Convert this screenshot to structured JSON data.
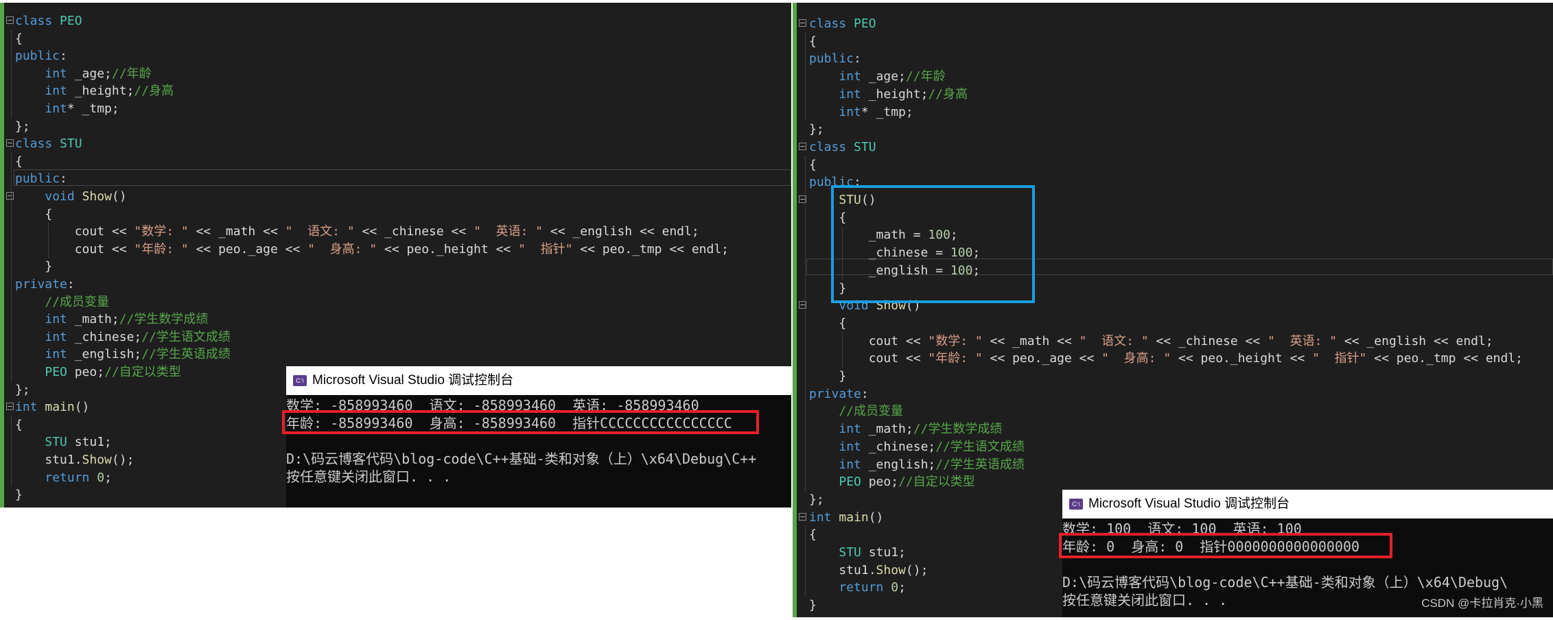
{
  "left_editor": {
    "lines": [
      [
        [
          "k",
          "class "
        ],
        [
          "t",
          "PEO"
        ]
      ],
      [
        [
          "m",
          "{"
        ]
      ],
      [
        [
          "k",
          "public"
        ],
        [
          "m",
          ":"
        ]
      ],
      [
        [
          "m",
          "    "
        ],
        [
          "k",
          "int"
        ],
        [
          "m",
          " _age;"
        ],
        [
          "c",
          "//年龄"
        ]
      ],
      [
        [
          "m",
          "    "
        ],
        [
          "k",
          "int"
        ],
        [
          "m",
          " _height;"
        ],
        [
          "c",
          "//身高"
        ]
      ],
      [
        [
          "m",
          "    "
        ],
        [
          "k",
          "int"
        ],
        [
          "m",
          "* _tmp;"
        ]
      ],
      [
        [
          "m",
          "};"
        ]
      ],
      [
        [
          "k",
          "class "
        ],
        [
          "t",
          "STU"
        ]
      ],
      [
        [
          "m",
          "{"
        ]
      ],
      [
        [
          "k",
          "public"
        ],
        [
          "m",
          ":"
        ]
      ],
      [
        [
          "m",
          "    "
        ],
        [
          "k",
          "void"
        ],
        [
          "m",
          " "
        ],
        [
          "f",
          "Show"
        ],
        [
          "m",
          "()"
        ]
      ],
      [
        [
          "m",
          "    {"
        ]
      ],
      [
        [
          "m",
          "        cout << "
        ],
        [
          "s",
          "\"数学: \""
        ],
        [
          "m",
          " << _math << "
        ],
        [
          "s",
          "\"  语文: \""
        ],
        [
          "m",
          " << _chinese << "
        ],
        [
          "s",
          "\"  英语: \""
        ],
        [
          "m",
          " << _english << endl;"
        ]
      ],
      [
        [
          "m",
          "        cout << "
        ],
        [
          "s",
          "\"年龄: \""
        ],
        [
          "m",
          " << peo._age << "
        ],
        [
          "s",
          "\"  身高: \""
        ],
        [
          "m",
          " << peo._height << "
        ],
        [
          "s",
          "\"  指针\""
        ],
        [
          "m",
          " << peo._tmp << endl;"
        ]
      ],
      [
        [
          "m",
          "    }"
        ]
      ],
      [
        [
          "k",
          "private"
        ],
        [
          "m",
          ":"
        ]
      ],
      [
        [
          "m",
          "    "
        ],
        [
          "c",
          "//成员变量"
        ]
      ],
      [
        [
          "m",
          "    "
        ],
        [
          "k",
          "int"
        ],
        [
          "m",
          " _math;"
        ],
        [
          "c",
          "//学生数学成绩"
        ]
      ],
      [
        [
          "m",
          "    "
        ],
        [
          "k",
          "int"
        ],
        [
          "m",
          " _chinese;"
        ],
        [
          "c",
          "//学生语文成绩"
        ]
      ],
      [
        [
          "m",
          "    "
        ],
        [
          "k",
          "int"
        ],
        [
          "m",
          " _english;"
        ],
        [
          "c",
          "//学生英语成绩"
        ]
      ],
      [
        [
          "m",
          "    "
        ],
        [
          "t",
          "PEO"
        ],
        [
          "m",
          " peo;"
        ],
        [
          "c",
          "//自定以类型"
        ]
      ],
      [
        [
          "m",
          "};"
        ]
      ],
      [
        [
          "k",
          "int"
        ],
        [
          "m",
          " "
        ],
        [
          "f",
          "main"
        ],
        [
          "m",
          "()"
        ]
      ],
      [
        [
          "m",
          "{"
        ]
      ],
      [
        [
          "m",
          "    "
        ],
        [
          "t",
          "STU"
        ],
        [
          "m",
          " stu1;"
        ]
      ],
      [
        [
          "m",
          "    stu1."
        ],
        [
          "f",
          "Show"
        ],
        [
          "m",
          "();"
        ]
      ],
      [
        [
          "m",
          "    "
        ],
        [
          "k",
          "return"
        ],
        [
          "m",
          " "
        ],
        [
          "n",
          "0"
        ],
        [
          "m",
          ";"
        ]
      ],
      [
        [
          "m",
          "}"
        ]
      ]
    ]
  },
  "right_editor": {
    "lines": [
      [
        [
          "k",
          "class "
        ],
        [
          "t",
          "PEO"
        ]
      ],
      [
        [
          "m",
          "{"
        ]
      ],
      [
        [
          "k",
          "public"
        ],
        [
          "m",
          ":"
        ]
      ],
      [
        [
          "m",
          "    "
        ],
        [
          "k",
          "int"
        ],
        [
          "m",
          " _age;"
        ],
        [
          "c",
          "//年龄"
        ]
      ],
      [
        [
          "m",
          "    "
        ],
        [
          "k",
          "int"
        ],
        [
          "m",
          " _height;"
        ],
        [
          "c",
          "//身高"
        ]
      ],
      [
        [
          "m",
          "    "
        ],
        [
          "k",
          "int"
        ],
        [
          "m",
          "* _tmp;"
        ]
      ],
      [
        [
          "m",
          "};"
        ]
      ],
      [
        [
          "k",
          "class "
        ],
        [
          "t",
          "STU"
        ]
      ],
      [
        [
          "m",
          "{"
        ]
      ],
      [
        [
          "k",
          "public"
        ],
        [
          "m",
          ":"
        ]
      ],
      [
        [
          "m",
          "    "
        ],
        [
          "f",
          "STU"
        ],
        [
          "m",
          "()"
        ]
      ],
      [
        [
          "m",
          "    {"
        ]
      ],
      [
        [
          "m",
          "        _math = "
        ],
        [
          "n",
          "100"
        ],
        [
          "m",
          ";"
        ]
      ],
      [
        [
          "m",
          "        _chinese = "
        ],
        [
          "n",
          "100"
        ],
        [
          "m",
          ";"
        ]
      ],
      [
        [
          "m",
          "        _english = "
        ],
        [
          "n",
          "100"
        ],
        [
          "m",
          ";"
        ]
      ],
      [
        [
          "m",
          "    }"
        ]
      ],
      [
        [
          "m",
          "    "
        ],
        [
          "k",
          "void"
        ],
        [
          "m",
          " "
        ],
        [
          "f",
          "Show"
        ],
        [
          "m",
          "()"
        ]
      ],
      [
        [
          "m",
          "    {"
        ]
      ],
      [
        [
          "m",
          "        cout << "
        ],
        [
          "s",
          "\"数学: \""
        ],
        [
          "m",
          " << _math << "
        ],
        [
          "s",
          "\"  语文: \""
        ],
        [
          "m",
          " << _chinese << "
        ],
        [
          "s",
          "\"  英语: \""
        ],
        [
          "m",
          " << _english << endl;"
        ]
      ],
      [
        [
          "m",
          "        cout << "
        ],
        [
          "s",
          "\"年龄: \""
        ],
        [
          "m",
          " << peo._age << "
        ],
        [
          "s",
          "\"  身高: \""
        ],
        [
          "m",
          " << peo._height << "
        ],
        [
          "s",
          "\"  指针\""
        ],
        [
          "m",
          " << peo._tmp << endl;"
        ]
      ],
      [
        [
          "m",
          "    }"
        ]
      ],
      [
        [
          "k",
          "private"
        ],
        [
          "m",
          ":"
        ]
      ],
      [
        [
          "m",
          "    "
        ],
        [
          "c",
          "//成员变量"
        ]
      ],
      [
        [
          "m",
          "    "
        ],
        [
          "k",
          "int"
        ],
        [
          "m",
          " _math;"
        ],
        [
          "c",
          "//学生数学成绩"
        ]
      ],
      [
        [
          "m",
          "    "
        ],
        [
          "k",
          "int"
        ],
        [
          "m",
          " _chinese;"
        ],
        [
          "c",
          "//学生语文成绩"
        ]
      ],
      [
        [
          "m",
          "    "
        ],
        [
          "k",
          "int"
        ],
        [
          "m",
          " _english;"
        ],
        [
          "c",
          "//学生英语成绩"
        ]
      ],
      [
        [
          "m",
          "    "
        ],
        [
          "t",
          "PEO"
        ],
        [
          "m",
          " peo;"
        ],
        [
          "c",
          "//自定以类型"
        ]
      ],
      [
        [
          "m",
          "};"
        ]
      ],
      [
        [
          "k",
          "int"
        ],
        [
          "m",
          " "
        ],
        [
          "f",
          "main"
        ],
        [
          "m",
          "()"
        ]
      ],
      [
        [
          "m",
          "{"
        ]
      ],
      [
        [
          "m",
          "    "
        ],
        [
          "t",
          "STU"
        ],
        [
          "m",
          " stu1;"
        ]
      ],
      [
        [
          "m",
          "    stu1."
        ],
        [
          "f",
          "Show"
        ],
        [
          "m",
          "();"
        ]
      ],
      [
        [
          "m",
          "    "
        ],
        [
          "k",
          "return"
        ],
        [
          "m",
          " "
        ],
        [
          "n",
          "0"
        ],
        [
          "m",
          ";"
        ]
      ],
      [
        [
          "m",
          "}"
        ]
      ]
    ]
  },
  "left_console": {
    "title": "Microsoft Visual Studio 调试控制台",
    "lines": [
      "数学: -858993460  语文: -858993460  英语: -858993460",
      "年龄: -858993460  身高: -858993460  指针CCCCCCCCCCCCCCCC",
      "",
      "D:\\码云博客代码\\blog-code\\C++基础-类和对象（上）\\x64\\Debug\\C++",
      "按任意键关闭此窗口. . ."
    ]
  },
  "right_console": {
    "title": "Microsoft Visual Studio 调试控制台",
    "lines": [
      "数学: 100  语文: 100  英语: 100",
      "年龄: 0  身高: 0  指针0000000000000000",
      "",
      "D:\\码云博客代码\\blog-code\\C++基础-类和对象（上）\\x64\\Debug\\",
      "按任意键关闭此窗口. . ."
    ]
  },
  "watermark": "CSDN @卡拉肖克·小黑",
  "colors": {
    "highlight_red": "#e8202a",
    "highlight_blue": "#1a9ee3",
    "editor_bg": "#1e1e1e",
    "console_bg": "#0c0c0c"
  }
}
